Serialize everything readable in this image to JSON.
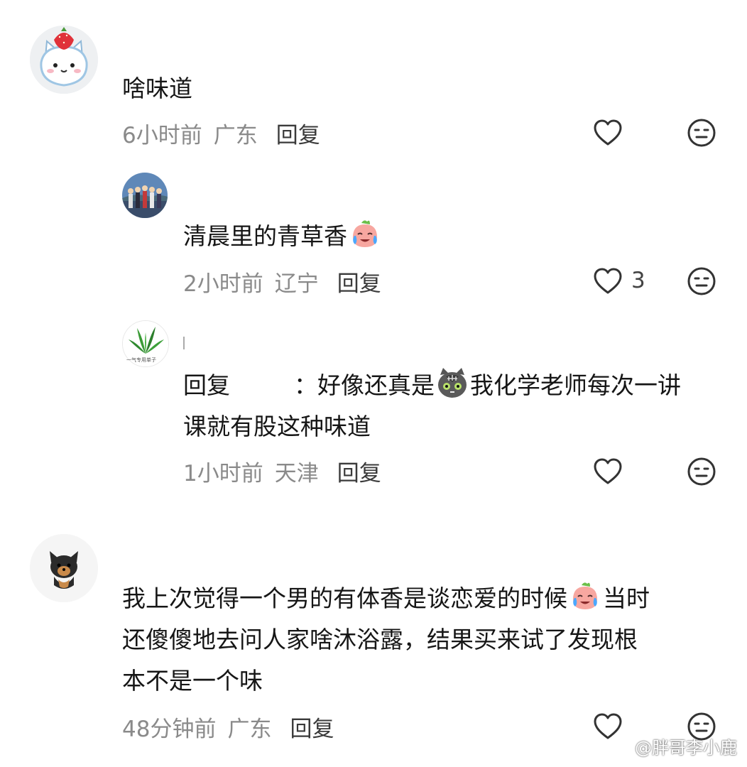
{
  "comments": [
    {
      "text_lines": [
        "啥味道"
      ],
      "time": "6小时前",
      "location": "广东",
      "reply_label": "回复",
      "avatar": "chiikawa-strawberry-avatar",
      "likes": ""
    },
    {
      "text_lines": [
        "清晨里的青草香"
      ],
      "time": "2小时前",
      "location": "辽宁",
      "reply_label": "回复",
      "avatar": "anime-group-avatar",
      "likes": "3"
    },
    {
      "reply_prefix": "回复",
      "reply_colon": "：",
      "text_part1": "好像还真是",
      "text_part2": "我化学老师每次一讲",
      "text_line2": "课就有股这种味道",
      "time": "1小时前",
      "location": "天津",
      "reply_label": "回复",
      "avatar": "plant-leaves-avatar",
      "avatar_caption": "一气专用单子",
      "likes": ""
    },
    {
      "line1_part1": "我上次觉得一个男的有体香是谈恋爱的时候",
      "line1_part2": "当时",
      "line2": "还傻傻地去问人家啥沐浴露，结果买来试了发现根",
      "line3": "本不是一个味",
      "time": "48分钟前",
      "location": "广东",
      "reply_label": "回复",
      "avatar": "puppy-avatar",
      "likes": ""
    }
  ],
  "watermark": "@胖哥李小鹿",
  "icons": {
    "like": "heart-outline-icon",
    "dislike": "neutral-face-icon",
    "crying_emoji": "crying-peach-emoji",
    "cat_emoji": "gray-cat-emoji",
    "weibo_logo": "weibo-logo-icon"
  }
}
